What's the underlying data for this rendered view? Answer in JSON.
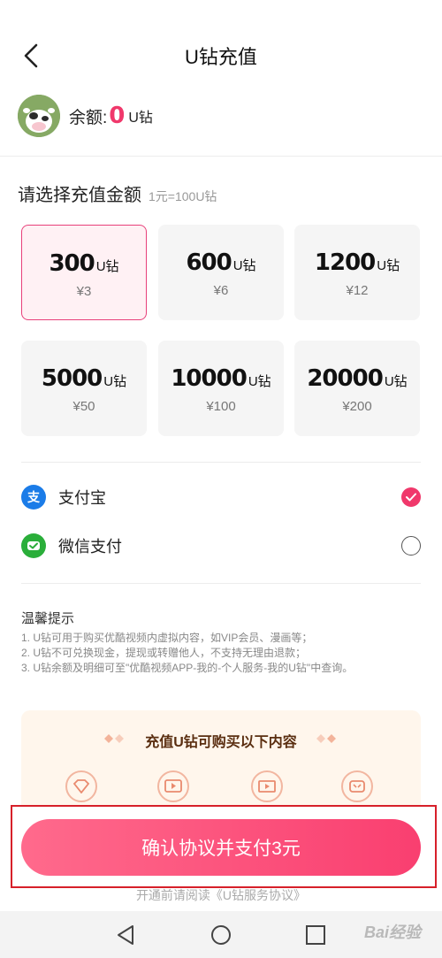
{
  "header": {
    "title": "U钻充值",
    "back_icon": "chevron-left-icon"
  },
  "balance": {
    "label": "余额:",
    "value": "0",
    "unit": "U钻"
  },
  "recharge": {
    "title": "请选择充值金额",
    "rate_hint": "1元=100U钻",
    "options": [
      {
        "amount": "300",
        "unit": "U钻",
        "price": "¥3",
        "selected": true
      },
      {
        "amount": "600",
        "unit": "U钻",
        "price": "¥6",
        "selected": false
      },
      {
        "amount": "1200",
        "unit": "U钻",
        "price": "¥12",
        "selected": false
      },
      {
        "amount": "5000",
        "unit": "U钻",
        "price": "¥50",
        "selected": false
      },
      {
        "amount": "10000",
        "unit": "U钻",
        "price": "¥100",
        "selected": false
      },
      {
        "amount": "20000",
        "unit": "U钻",
        "price": "¥200",
        "selected": false
      }
    ]
  },
  "payment": {
    "methods": [
      {
        "label": "支付宝",
        "icon": "alipay-icon",
        "checked": true
      },
      {
        "label": "微信支付",
        "icon": "wechat-pay-icon",
        "checked": false
      }
    ]
  },
  "tips": {
    "title": "温馨提示",
    "lines": [
      "1. U钻可用于购买优酷视频内虚拟内容，如VIP会员、漫画等；",
      "2. U钻不可兑换现金，提现或转赠他人，不支持无理由退款；",
      "3. U钻余额及明细可至\"优酷视频APP-我的-个人服务-我的U钻\"中查询。"
    ]
  },
  "promo": {
    "title": "充值U钻可购买以下内容",
    "icons": [
      "diamond-icon",
      "video-play-icon",
      "film-icon",
      "comic-icon"
    ]
  },
  "cta": {
    "label": "确认协议并支付3元",
    "agreement": "开通前请阅读《U钻服务协议》"
  },
  "navbar": {
    "icons": [
      "back-triangle-icon",
      "home-circle-icon",
      "recent-square-icon"
    ]
  },
  "watermark": "Bai经验",
  "colors": {
    "accent": "#f0386b",
    "selected_bg": "#fff1f4",
    "card_bg": "#f5f5f5",
    "promo_bg": "#fff6ec",
    "highlight_frame": "#d7202a"
  }
}
